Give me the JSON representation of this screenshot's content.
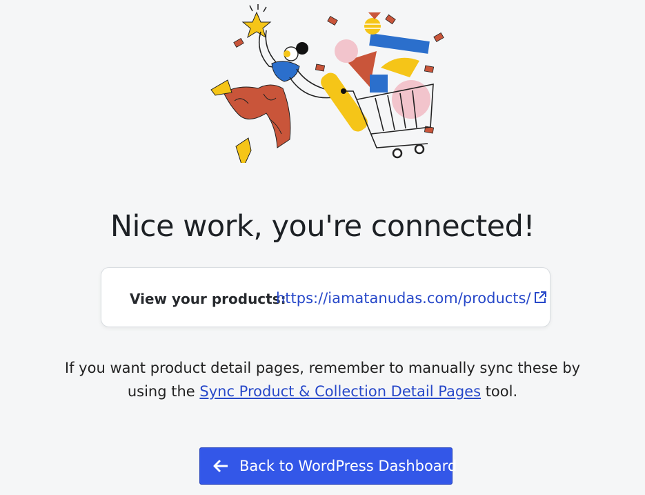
{
  "headline": "Nice work, you're connected!",
  "products": {
    "label": "View your products:",
    "url_text": "https://iamatanudas.com/products/"
  },
  "note": {
    "before": "If you want product detail pages, remember to manually sync these by",
    "line2_prefix": "using the",
    "link_text": "Sync Product & Collection Detail Pages",
    "suffix": "tool."
  },
  "back_button": {
    "label": "Back to WordPress Dashboard"
  },
  "colors": {
    "accent": "#3357e8",
    "link": "#2748c9",
    "background": "#f5f6f7"
  },
  "icons": {
    "external": "external-link-icon",
    "arrow": "arrow-left-icon",
    "illustration": "shopping-cart-illustration"
  }
}
